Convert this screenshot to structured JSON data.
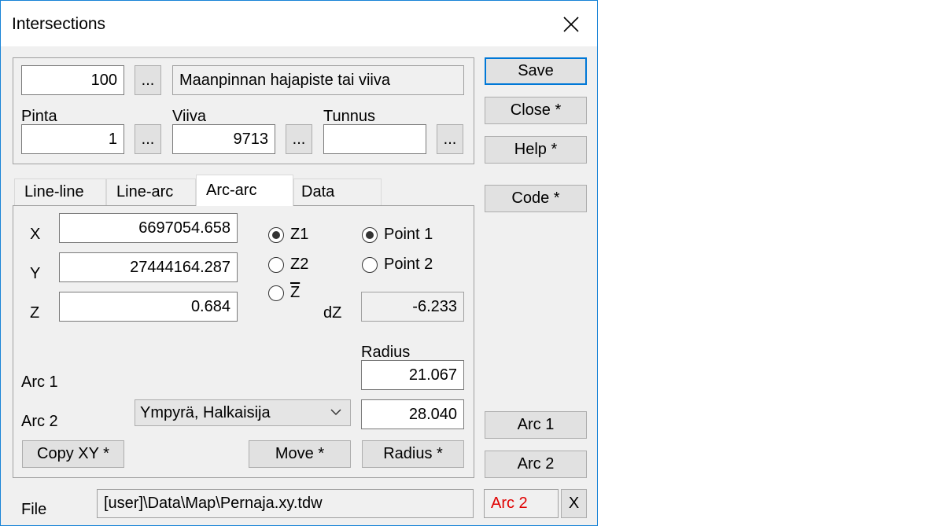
{
  "window": {
    "title": "Intersections"
  },
  "top": {
    "code_value": "100",
    "code_description": "Maanpinnan hajapiste tai viiva",
    "pinta_label": "Pinta",
    "pinta_value": "1",
    "viiva_label": "Viiva",
    "viiva_value": "9713",
    "tunnus_label": "Tunnus",
    "tunnus_value": "",
    "browse_label": "..."
  },
  "right_buttons": {
    "save": "Save",
    "close": "Close *",
    "help": "Help *",
    "code": "Code *",
    "arc1": "Arc 1",
    "arc2": "Arc 2"
  },
  "tabs": [
    "Line-line",
    "Line-arc",
    "Arc-arc",
    "Data"
  ],
  "active_tab": "Arc-arc",
  "coords": {
    "x_label": "X",
    "x_value": "6697054.658",
    "y_label": "Y",
    "y_value": "27444164.287",
    "z_label": "Z",
    "z_value": "0.684",
    "dz_label": "dZ",
    "dz_value": "-6.233"
  },
  "z_options": [
    {
      "label": "Z1",
      "selected": true
    },
    {
      "label": "Z2",
      "selected": false
    },
    {
      "label": "Z",
      "selected": false
    }
  ],
  "point_options": [
    {
      "label": "Point 1",
      "selected": true
    },
    {
      "label": "Point 2",
      "selected": false
    }
  ],
  "arcs": {
    "radius_label": "Radius",
    "arc1_label": "Arc 1",
    "arc1_radius": "21.067",
    "arc2_label": "Arc 2",
    "arc2_type": "Ympyrä, Halkaisija",
    "arc2_radius": "28.040"
  },
  "bottom_buttons": {
    "copy_xy": "Copy XY *",
    "move": "Move *",
    "radius": "Radius *"
  },
  "file": {
    "label": "File",
    "path": "[user]\\Data\\Map\\Pernaja.xy.tdw",
    "status": "Arc 2",
    "status_color": "#e00000",
    "clear": "X"
  },
  "icons": {
    "close": "close-icon",
    "combo": "chevron-down-icon"
  }
}
